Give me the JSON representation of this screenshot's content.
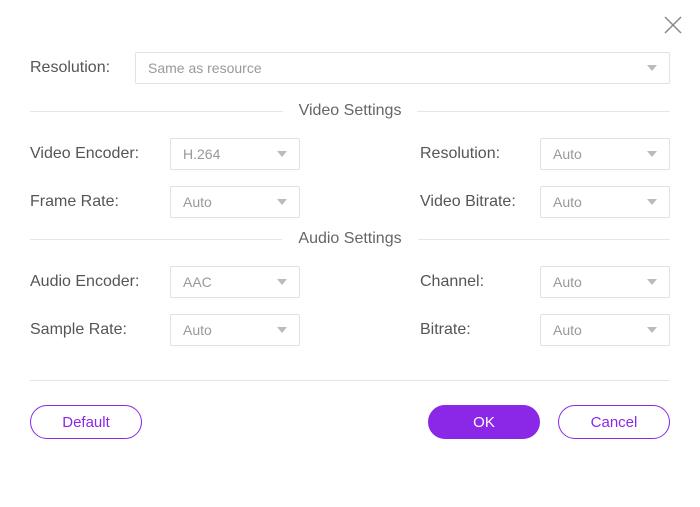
{
  "top": {
    "resolution_label": "Resolution:",
    "resolution_value": "Same as resource"
  },
  "video": {
    "section_title": "Video Settings",
    "encoder_label": "Video Encoder:",
    "encoder_value": "H.264",
    "resolution_label": "Resolution:",
    "resolution_value": "Auto",
    "framerate_label": "Frame Rate:",
    "framerate_value": "Auto",
    "bitrate_label": "Video Bitrate:",
    "bitrate_value": "Auto"
  },
  "audio": {
    "section_title": "Audio Settings",
    "encoder_label": "Audio Encoder:",
    "encoder_value": "AAC",
    "channel_label": "Channel:",
    "channel_value": "Auto",
    "samplerate_label": "Sample Rate:",
    "samplerate_value": "Auto",
    "bitrate_label": "Bitrate:",
    "bitrate_value": "Auto"
  },
  "buttons": {
    "default": "Default",
    "ok": "OK",
    "cancel": "Cancel"
  },
  "colors": {
    "accent": "#8b27e6",
    "border": "#e2e2e2",
    "text": "#555"
  }
}
